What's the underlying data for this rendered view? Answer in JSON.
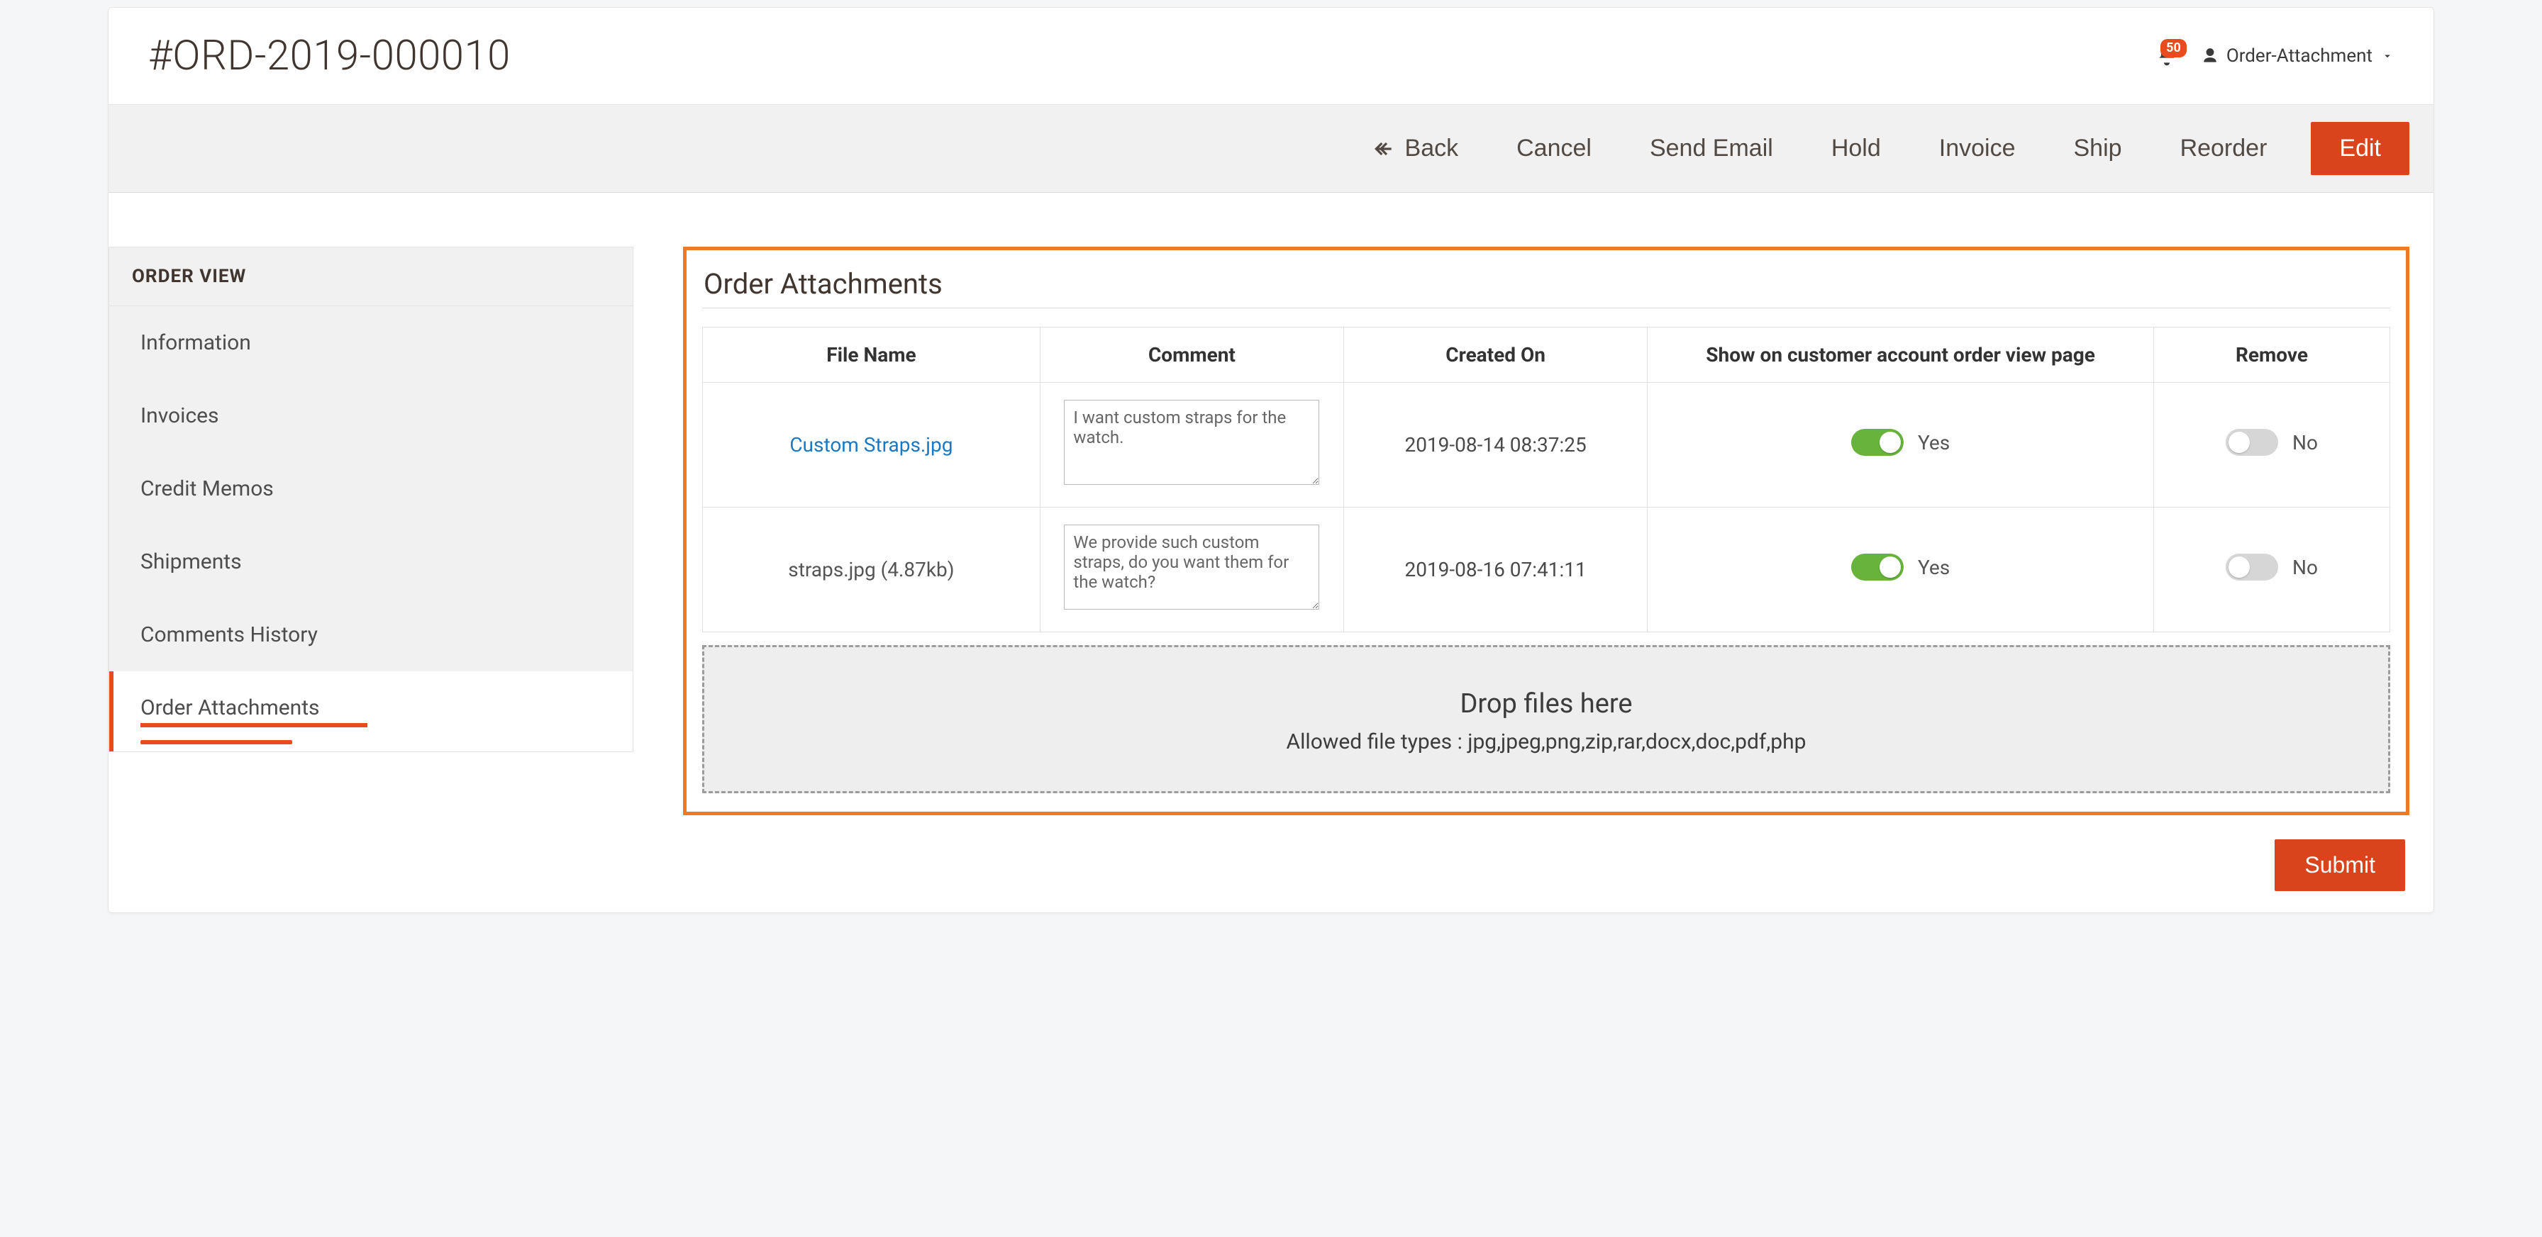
{
  "header": {
    "order_title": "#ORD-2019-000010",
    "notifications_count": "50",
    "user_label": "Order-Attachment"
  },
  "actions": {
    "back": "Back",
    "cancel": "Cancel",
    "send_email": "Send Email",
    "hold": "Hold",
    "invoice": "Invoice",
    "ship": "Ship",
    "reorder": "Reorder",
    "edit": "Edit"
  },
  "sidebar": {
    "title": "ORDER VIEW",
    "items": [
      {
        "label": "Information"
      },
      {
        "label": "Invoices"
      },
      {
        "label": "Credit Memos"
      },
      {
        "label": "Shipments"
      },
      {
        "label": "Comments History"
      },
      {
        "label": "Order Attachments",
        "selected": true
      }
    ]
  },
  "panel": {
    "title": "Order Attachments",
    "columns": {
      "file_name": "File Name",
      "comment": "Comment",
      "created_on": "Created On",
      "show_on_customer": "Show on customer account order view page",
      "remove": "Remove"
    },
    "rows": [
      {
        "file_display": "Custom Straps.jpg",
        "file_is_link": true,
        "comment": "I want custom straps for the watch.",
        "created_on": "2019-08-14 08:37:25",
        "show_on_customer": {
          "on": true,
          "label": "Yes"
        },
        "remove": {
          "on": false,
          "label": "No"
        }
      },
      {
        "file_display": "straps.jpg (4.87kb)",
        "file_is_link": false,
        "comment": "We provide such custom straps, do you want them for the watch?",
        "created_on": "2019-08-16 07:41:11",
        "show_on_customer": {
          "on": true,
          "label": "Yes"
        },
        "remove": {
          "on": false,
          "label": "No"
        }
      }
    ],
    "dropzone": {
      "title": "Drop files here",
      "subtitle": "Allowed file types : jpg,jpeg,png,zip,rar,docx,doc,pdf,php"
    },
    "submit_label": "Submit"
  }
}
